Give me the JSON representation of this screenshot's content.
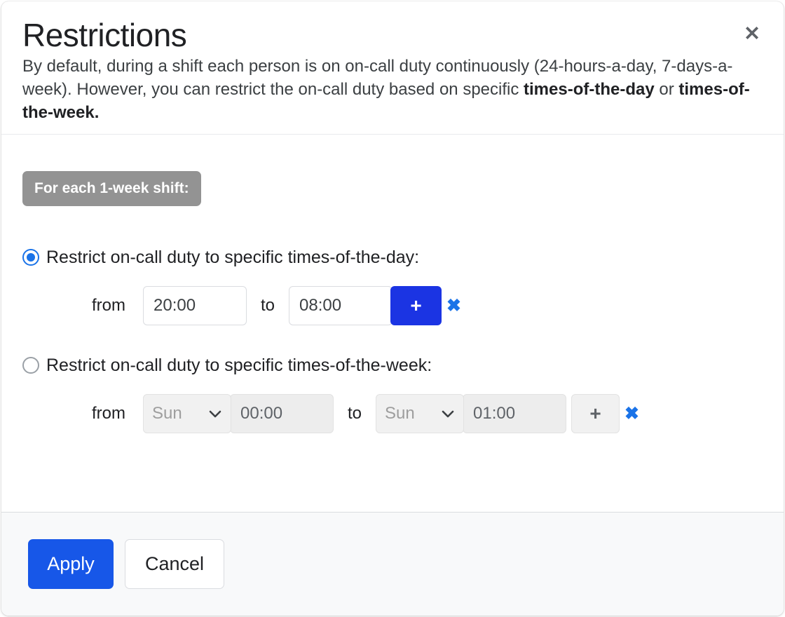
{
  "dialog": {
    "title": "Restrictions",
    "description_parts": {
      "lead": "By default, during a shift each person is on on-call duty continuously (24-hours-a-day, 7-days-a-week). However, you can restrict the on-call duty based on specific ",
      "bold_1": "times-of-the-day",
      "middle": " or ",
      "bold_2": "times-of-the-week."
    },
    "close_label": "✕"
  },
  "body": {
    "shift_badge": "For each 1-week shift:",
    "options": [
      {
        "id": "times-of-the-day",
        "label": "Restrict on-call duty to specific times-of-the-day:",
        "selected": true,
        "row": {
          "from_label": "from",
          "from_value": "20:00",
          "to_label": "to",
          "to_value": "08:00",
          "add_label": "+",
          "remove_label": "✖",
          "add_enabled": true
        }
      },
      {
        "id": "times-of-the-week",
        "label": "Restrict on-call duty to specific times-of-the-week:",
        "selected": false,
        "row": {
          "from_label": "from",
          "from_day": "Sun",
          "from_value": "00:00",
          "to_label": "to",
          "to_day": "Sun",
          "to_value": "01:00",
          "add_label": "+",
          "remove_label": "✖",
          "add_enabled": false
        }
      }
    ]
  },
  "footer": {
    "apply_label": "Apply",
    "cancel_label": "Cancel"
  },
  "colors": {
    "accent_blue": "#1a73e8",
    "add_button_blue": "#1b34e3",
    "apply_blue": "#1757e8",
    "badge_gray": "#939393",
    "footer_bg": "#f8f9fa"
  }
}
